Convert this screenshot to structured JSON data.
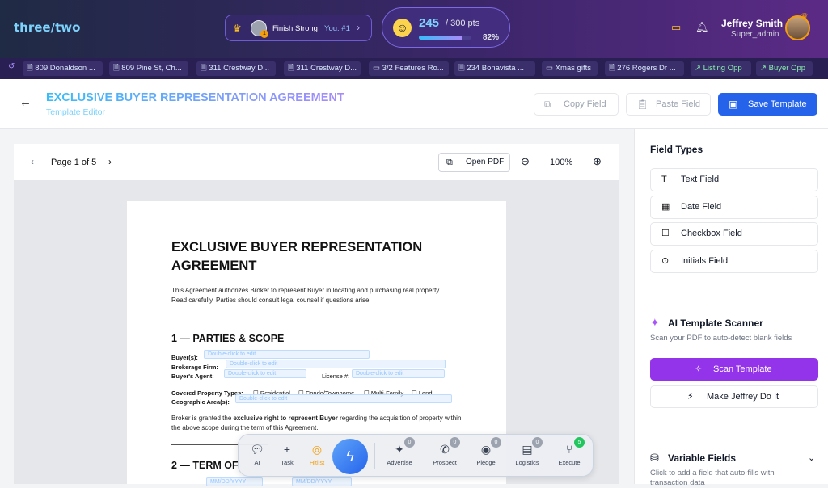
{
  "app": {
    "logo": "three/two"
  },
  "streak": {
    "label": "Finish Strong",
    "rank": "You: #1",
    "badge": "1"
  },
  "points": {
    "value": "245",
    "max": "/ 300 pts",
    "percent_label": "82%",
    "progress": 0.82
  },
  "user": {
    "name": "Jeffrey Smith",
    "role": "Super_admin"
  },
  "tabs": [
    {
      "label": "809 Donaldson ...",
      "icon": "document-icon"
    },
    {
      "label": "809 Pine St, Ch...",
      "icon": "document-icon"
    },
    {
      "label": "311 Crestway D...",
      "icon": "document-icon"
    },
    {
      "label": "311 Crestway D...",
      "icon": "document-icon"
    },
    {
      "label": "3/2 Features Ro...",
      "icon": "folder-icon"
    },
    {
      "label": "234 Bonavista ...",
      "icon": "document-icon"
    },
    {
      "label": "Xmas gifts",
      "icon": "folder-icon"
    },
    {
      "label": "276 Rogers Dr ...",
      "icon": "document-icon"
    },
    {
      "label": "Listing Opp",
      "icon": "trend-icon"
    },
    {
      "label": "Buyer Opp",
      "icon": "trend-icon"
    }
  ],
  "header": {
    "title": "EXCLUSIVE BUYER REPRESENTATION AGREEMENT",
    "subtitle": "Template Editor",
    "copy_label": "Copy Field",
    "paste_label": "Paste Field",
    "save_label": "Save Template"
  },
  "viewer": {
    "page_label": "Page 1 of 5",
    "open_pdf": "Open PDF",
    "zoom": "100%"
  },
  "document": {
    "title": "EXCLUSIVE BUYER REPRESENTATION AGREEMENT",
    "intro": "This Agreement authorizes Broker to represent Buyer in locating and purchasing real property. Read carefully. Parties should consult legal counsel if questions arise.",
    "section1": "1 — PARTIES & SCOPE",
    "buyer_label": "Buyer(s):",
    "brokerage_label": "Brokerage Firm:",
    "agent_label": "Buyer's Agent:",
    "license_label": "License #:",
    "covered_label": "Covered Property Types:",
    "geo_label": "Geographic Area(s):",
    "placeholder": "Double-click to edit",
    "cb_residential": "Residential",
    "cb_condo": "Condo/Townhome",
    "cb_multi": "Multi-Family",
    "cb_land": "Land",
    "body_pre": "Broker is granted the ",
    "body_bold": "exclusive right to represent Buyer",
    "body_post": " regarding the acquisition of property within the above scope during the term of this Agreement.",
    "section2": "2 — TERM OF",
    "date_placeholder": "MM/DD/YYYY"
  },
  "panel": {
    "field_types_title": "Field Types",
    "field_types": [
      {
        "label": "Text Field",
        "icon": "text-icon"
      },
      {
        "label": "Date Field",
        "icon": "calendar-icon"
      },
      {
        "label": "Checkbox Field",
        "icon": "checkbox-icon"
      },
      {
        "label": "Initials Field",
        "icon": "initials-icon"
      }
    ],
    "ai_title": "AI Template Scanner",
    "ai_desc": "Scan your PDF to auto-detect blank fields",
    "scan_label": "Scan Template",
    "jeffrey_label": "Make Jeffrey Do It",
    "variable_title": "Variable Fields",
    "variable_desc": "Click to add a field that auto-fills with transaction data"
  },
  "dock": {
    "items": [
      {
        "label": "AI",
        "icon": "chat-icon"
      },
      {
        "label": "Task",
        "icon": "plus-icon"
      },
      {
        "label": "Hitlist",
        "icon": "target-icon"
      },
      {
        "label": "Advertise",
        "icon": "sparkle-icon",
        "badge": "0"
      },
      {
        "label": "Prospect",
        "icon": "phone-icon",
        "badge": "0"
      },
      {
        "label": "Pledge",
        "icon": "fingerprint-icon",
        "badge": "0"
      },
      {
        "label": "Logistics",
        "icon": "briefcase-icon",
        "badge": "0"
      },
      {
        "label": "Execute",
        "icon": "branch-icon",
        "badge": "5"
      }
    ]
  },
  "colors": {
    "accent": "#2563eb",
    "ai_purple": "#9333ea",
    "topbar": "#3a2668"
  }
}
